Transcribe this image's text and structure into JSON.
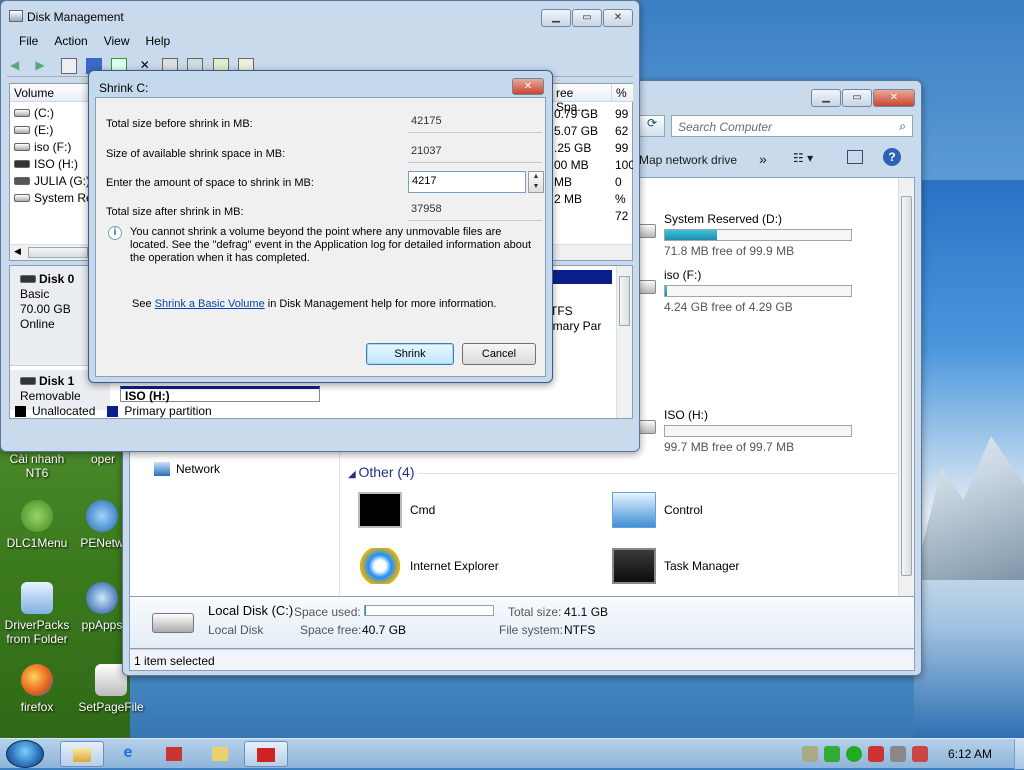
{
  "desktop": {
    "icons": [
      {
        "label": "Cài nhanh NT6"
      },
      {
        "label": "oper"
      },
      {
        "label": "DLC1Menu"
      },
      {
        "label": "PENetw"
      },
      {
        "label": "DriverPacks from Folder"
      },
      {
        "label": "ppApps"
      },
      {
        "label": "firefox"
      },
      {
        "label": "SetPageFile"
      }
    ]
  },
  "explorer": {
    "search_placeholder": "Search Computer",
    "toolbar": {
      "map_drive": "Map network drive",
      "more": "»"
    },
    "nav": {
      "network": "Network"
    },
    "drives": [
      {
        "name": "System Reserved (D:)",
        "free": "71.8 MB free of 99.9 MB",
        "used_fraction": 0.28
      },
      {
        "name": "iso (F:)",
        "free": "4.24 GB free of 4.29 GB",
        "used_fraction": 0.01
      },
      {
        "name": "ISO (H:)",
        "free": "99.7 MB free of 99.7 MB",
        "used_fraction": 0.0
      }
    ],
    "other_group": {
      "title": "Other (4)"
    },
    "apps": [
      {
        "label": "Cmd",
        "icon": "cmd-icon"
      },
      {
        "label": "Control",
        "icon": "control-panel-icon"
      },
      {
        "label": "Internet Explorer",
        "icon": "internet-explorer-icon"
      },
      {
        "label": "Task Manager",
        "icon": "task-manager-icon"
      }
    ],
    "details": {
      "name": "Local Disk (C:)",
      "type": "Local Disk",
      "space_used_label": "Space used:",
      "space_used_fraction": 0.01,
      "space_free_label": "Space free:",
      "space_free": "40.7 GB",
      "total_size_label": "Total size:",
      "total_size": "41.1 GB",
      "fs_label": "File system:",
      "fs": "NTFS"
    },
    "status": "1 item selected"
  },
  "diskmgmt": {
    "title": "Disk Management",
    "menu": [
      "File",
      "Action",
      "View",
      "Help"
    ],
    "columns": {
      "volume": "Volume",
      "free_space": "ree Spa...",
      "pct": "% F"
    },
    "volumes": [
      {
        "name": "(C:)",
        "free": "0.79 GB",
        "pct": "99"
      },
      {
        "name": "(E:)",
        "free": "5.07 GB",
        "pct": "62"
      },
      {
        "name": "iso (F:)",
        "free": ".25 GB",
        "pct": "99"
      },
      {
        "name": "ISO (H:)",
        "free": "00 MB",
        "pct": "100"
      },
      {
        "name": "JULIA (G:)",
        "free": "MB",
        "pct": "0 %"
      },
      {
        "name": "System Res",
        "free": "2 MB",
        "pct": "72"
      }
    ],
    "disks": [
      {
        "name": "Disk 0",
        "type": "Basic",
        "size": "70.00 GB",
        "status": "Online"
      },
      {
        "name": "Disk 1",
        "type": "Removable",
        "size": "",
        "status": ""
      }
    ],
    "partition_fragments": {
      "fs": "TFS",
      "kind": "imary Par",
      "iso": "ISO  (H:)"
    },
    "legend": {
      "unallocated": "Unallocated",
      "primary": "Primary partition"
    }
  },
  "shrink": {
    "title": "Shrink C:",
    "rows": [
      {
        "label": "Total size before shrink in MB:",
        "value": "42175"
      },
      {
        "label": "Size of available shrink space in MB:",
        "value": "21037"
      },
      {
        "label": "Enter the amount of space to shrink in MB:",
        "value": "4217"
      },
      {
        "label": "Total size after shrink in MB:",
        "value": "37958"
      }
    ],
    "info": "You cannot shrink a volume beyond the point where any unmovable files are located. See the \"defrag\" event in the Application log for detailed information about the operation when it has completed.",
    "see_prefix": "See",
    "see_link": "Shrink a Basic Volume",
    "see_suffix": "in Disk Management help for more information.",
    "shrink_button": "Shrink",
    "cancel_button": "Cancel"
  },
  "taskbar": {
    "clock": "6:12 AM"
  },
  "colors": {
    "accent": "#1f8fb3",
    "link": "#0645ad",
    "legend_unallocated": "#000000",
    "legend_primary": "#0a1f8c"
  }
}
